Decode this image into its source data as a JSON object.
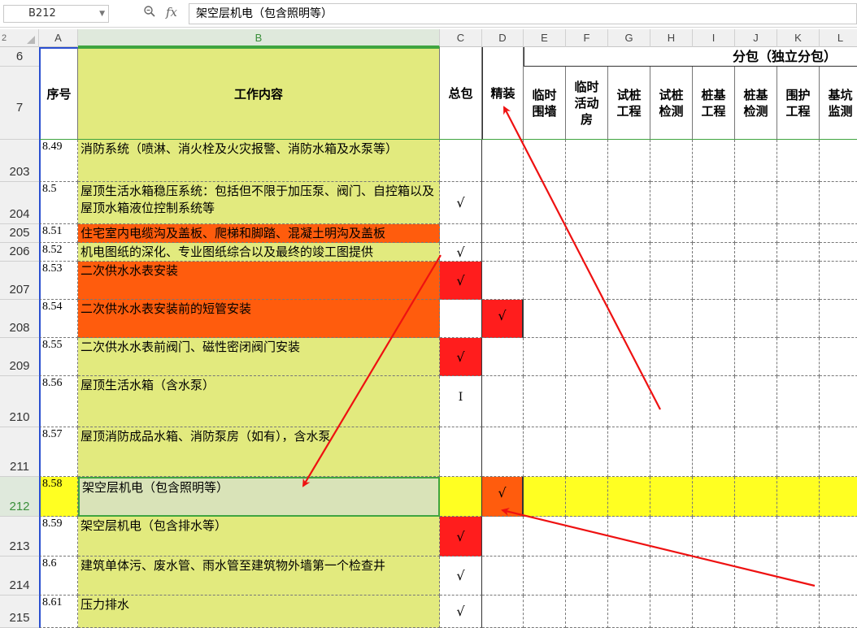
{
  "formula_bar": {
    "name_box": "B212",
    "zoom_icon": "magnifier-icon",
    "fx_label": "fx",
    "content": "架空层机电（包含照明等）"
  },
  "corner_label": "2",
  "columns": [
    "A",
    "B",
    "C",
    "D",
    "E",
    "F",
    "G",
    "H",
    "I",
    "J",
    "K",
    "L"
  ],
  "header": {
    "row6_label": "6",
    "row7_label": "7",
    "seq": "序号",
    "work": "工作内容",
    "general": "总包",
    "fitout": "精装",
    "subcontract_group": "分包（独立分包）",
    "sub_cols": [
      "临时\n围墙",
      "临时\n活动\n房",
      "试桩\n工程",
      "试桩\n检测",
      "桩基\n工程",
      "桩基\n检测",
      "围护\n工程",
      "基坑\n监测"
    ]
  },
  "rows": [
    {
      "row": "203",
      "seq": "8.49",
      "text": "消防系统（喷淋、消火栓及火灾报警、消防水箱及水泵等）",
      "c": "",
      "d": ""
    },
    {
      "row": "204",
      "seq": "8.5",
      "text": "屋顶生活水箱稳压系统：包括但不限于加压泵、阀门、自控箱以及屋顶水箱液位控制系统等",
      "c": "√",
      "d": ""
    },
    {
      "row": "205",
      "seq": "8.51",
      "text": "住宅室内电缆沟及盖板、爬梯和脚踏、混凝土明沟及盖板",
      "c": "",
      "d": ""
    },
    {
      "row": "206",
      "seq": "8.52",
      "text": "机电图纸的深化、专业图纸综合以及最终的竣工图提供",
      "c": "√",
      "d": ""
    },
    {
      "row": "207",
      "seq": "8.53",
      "text": "二次供水水表安装",
      "c": "√",
      "d": ""
    },
    {
      "row": "208",
      "seq": "8.54",
      "text": "二次供水水表安装前的短管安装",
      "c": "",
      "d": "√"
    },
    {
      "row": "209",
      "seq": "8.55",
      "text": "二次供水水表前阀门、磁性密闭阀门安装",
      "c": "√",
      "d": ""
    },
    {
      "row": "210",
      "seq": "8.56",
      "text": "屋顶生活水箱（含水泵）",
      "c": "I",
      "d": ""
    },
    {
      "row": "211",
      "seq": "8.57",
      "text": "屋顶消防成品水箱、消防泵房（如有），含水泵",
      "c": "",
      "d": ""
    },
    {
      "row": "212",
      "seq": "8.58",
      "text": "架空层机电（包含照明等）",
      "c": "",
      "d": "√"
    },
    {
      "row": "213",
      "seq": "8.59",
      "text": "架空层机电（包含排水等）",
      "c": "√",
      "d": ""
    },
    {
      "row": "214",
      "seq": "8.6",
      "text": "建筑单体污、废水管、雨水管至建筑物外墙第一个检查井",
      "c": "√",
      "d": ""
    },
    {
      "row": "215",
      "seq": "8.61",
      "text": "压力排水",
      "c": "√",
      "d": ""
    }
  ],
  "colors": {
    "light_green": "#e2ea7e",
    "orange": "#ff5c0d",
    "red": "#ff1d1d",
    "yellow": "#ffff22",
    "selection_green": "#3fa53f",
    "annotation_arrow": "#ee1111"
  }
}
